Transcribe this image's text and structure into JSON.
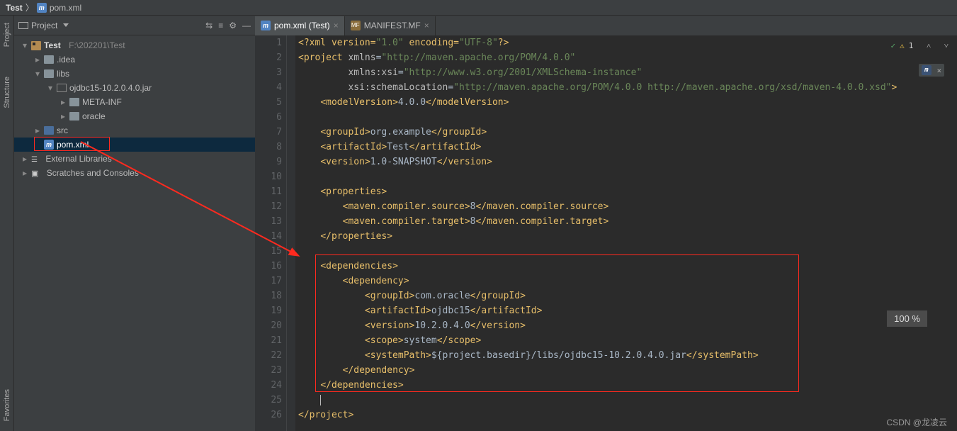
{
  "breadcrumb": {
    "root": "Test",
    "file": "pom.xml"
  },
  "sidebar": {
    "title": "Project",
    "tree": {
      "root": "Test",
      "rootPath": "F:\\202201\\Test",
      "idea": ".idea",
      "libs": "libs",
      "jar": "ojdbc15-10.2.0.4.0.jar",
      "meta": "META-INF",
      "oracle": "oracle",
      "src": "src",
      "pom": "pom.xml",
      "ext": "External Libraries",
      "scratch": "Scratches and Consoles"
    }
  },
  "vtabs": {
    "proj": "Project",
    "struct": "Structure",
    "fav": "Favorites"
  },
  "tabs": [
    {
      "label": "pom.xml (Test)",
      "active": true
    },
    {
      "label": "MANIFEST.MF",
      "active": false
    }
  ],
  "inspection": {
    "issues": "1"
  },
  "zoom": "100 %",
  "watermark": "CSDN @龙凌云",
  "maven_icon": "m",
  "chart_data": {
    "type": "table",
    "title": "pom.xml",
    "rows": [
      {
        "line": 1,
        "text": "<?xml version=\"1.0\" encoding=\"UTF-8\"?>"
      },
      {
        "line": 2,
        "text": "<project xmlns=\"http://maven.apache.org/POM/4.0.0\""
      },
      {
        "line": 3,
        "text": "         xmlns:xsi=\"http://www.w3.org/2001/XMLSchema-instance\""
      },
      {
        "line": 4,
        "text": "         xsi:schemaLocation=\"http://maven.apache.org/POM/4.0.0 http://maven.apache.org/xsd/maven-4.0.0.xsd\">"
      },
      {
        "line": 5,
        "text": "    <modelVersion>4.0.0</modelVersion>"
      },
      {
        "line": 6,
        "text": ""
      },
      {
        "line": 7,
        "text": "    <groupId>org.example</groupId>"
      },
      {
        "line": 8,
        "text": "    <artifactId>Test</artifactId>"
      },
      {
        "line": 9,
        "text": "    <version>1.0-SNAPSHOT</version>"
      },
      {
        "line": 10,
        "text": ""
      },
      {
        "line": 11,
        "text": "    <properties>"
      },
      {
        "line": 12,
        "text": "        <maven.compiler.source>8</maven.compiler.source>"
      },
      {
        "line": 13,
        "text": "        <maven.compiler.target>8</maven.compiler.target>"
      },
      {
        "line": 14,
        "text": "    </properties>"
      },
      {
        "line": 15,
        "text": ""
      },
      {
        "line": 16,
        "text": "    <dependencies>"
      },
      {
        "line": 17,
        "text": "        <dependency>"
      },
      {
        "line": 18,
        "text": "            <groupId>com.oracle</groupId>"
      },
      {
        "line": 19,
        "text": "            <artifactId>ojdbc15</artifactId>"
      },
      {
        "line": 20,
        "text": "            <version>10.2.0.4.0</version>"
      },
      {
        "line": 21,
        "text": "            <scope>system</scope>"
      },
      {
        "line": 22,
        "text": "            <systemPath>${project.basedir}/libs/ojdbc15-10.2.0.4.0.jar</systemPath>"
      },
      {
        "line": 23,
        "text": "        </dependency>"
      },
      {
        "line": 24,
        "text": "    </dependencies>"
      },
      {
        "line": 25,
        "text": ""
      },
      {
        "line": 26,
        "text": "</project>"
      }
    ]
  },
  "code_html": [
    "<span class='t-br'>&lt;?</span><span class='t-decl'>xml version=</span><span class='t-str'>\"1.0\"</span><span class='t-decl'> encoding=</span><span class='t-str'>\"UTF-8\"</span><span class='t-br'>?&gt;</span>",
    "<span class='t-br'>&lt;</span><span class='t-tag'>project </span><span class='t-attr'>xmlns</span>=<span class='t-str'>\"http://maven.apache.org/POM/4.0.0\"</span>",
    "         <span class='t-attr'>xmlns:xsi</span>=<span class='t-str'>\"http://www.w3.org/2001/XMLSchema-instance\"</span>",
    "         <span class='t-attr'>xsi:schemaLocation</span>=<span class='t-str'>\"http://maven.apache.org/POM/4.0.0 http://maven.apache.org/xsd/maven-4.0.0.xsd\"</span><span class='t-br'>&gt;</span>",
    "    <span class='t-br'>&lt;</span><span class='t-tag'>modelVersion</span><span class='t-br'>&gt;</span>4.0.0<span class='t-br'>&lt;/</span><span class='t-tag'>modelVersion</span><span class='t-br'>&gt;</span>",
    "",
    "    <span class='t-br'>&lt;</span><span class='t-tag'>groupId</span><span class='t-br'>&gt;</span>org.example<span class='t-br'>&lt;/</span><span class='t-tag'>groupId</span><span class='t-br'>&gt;</span>",
    "    <span class='t-br'>&lt;</span><span class='t-tag'>artifactId</span><span class='t-br'>&gt;</span>Test<span class='t-br'>&lt;/</span><span class='t-tag'>artifactId</span><span class='t-br'>&gt;</span>",
    "    <span class='t-br'>&lt;</span><span class='t-tag'>version</span><span class='t-br'>&gt;</span>1.0-SNAPSHOT<span class='t-br'>&lt;/</span><span class='t-tag'>version</span><span class='t-br'>&gt;</span>",
    "",
    "    <span class='t-br'>&lt;</span><span class='t-tag'>properties</span><span class='t-br'>&gt;</span>",
    "        <span class='t-br'>&lt;</span><span class='t-tag'>maven.compiler.source</span><span class='t-br'>&gt;</span>8<span class='t-br'>&lt;/</span><span class='t-tag'>maven.compiler.source</span><span class='t-br'>&gt;</span>",
    "        <span class='t-br'>&lt;</span><span class='t-tag'>maven.compiler.target</span><span class='t-br'>&gt;</span>8<span class='t-br'>&lt;/</span><span class='t-tag'>maven.compiler.target</span><span class='t-br'>&gt;</span>",
    "    <span class='t-br'>&lt;/</span><span class='t-tag'>properties</span><span class='t-br'>&gt;</span>",
    "",
    "    <span class='t-br'>&lt;</span><span class='t-tag'>dependencies</span><span class='t-br'>&gt;</span>",
    "        <span class='t-br'>&lt;</span><span class='t-tag'>dependency</span><span class='t-br'>&gt;</span>",
    "            <span class='t-br'>&lt;</span><span class='t-tag'>groupId</span><span class='t-br'>&gt;</span>com.oracle<span class='t-br'>&lt;/</span><span class='t-tag'>groupId</span><span class='t-br'>&gt;</span>",
    "            <span class='t-br'>&lt;</span><span class='t-tag'>artifactId</span><span class='t-br'>&gt;</span>ojdbc15<span class='t-br'>&lt;/</span><span class='t-tag'>artifactId</span><span class='t-br'>&gt;</span>",
    "            <span class='t-br'>&lt;</span><span class='t-tag'>version</span><span class='t-br'>&gt;</span>10.2.0.4.0<span class='t-br'>&lt;/</span><span class='t-tag'>version</span><span class='t-br'>&gt;</span>",
    "            <span class='t-br'>&lt;</span><span class='t-tag'>scope</span><span class='t-br'>&gt;</span>system<span class='t-br'>&lt;/</span><span class='t-tag'>scope</span><span class='t-br'>&gt;</span>",
    "            <span class='t-br'>&lt;</span><span class='t-tag'>systemPath</span><span class='t-br'>&gt;</span>${project.basedir}/libs/ojdbc15-10.2.0.4.0.jar<span class='t-br'>&lt;/</span><span class='t-tag'>systemPath</span><span class='t-br'>&gt;</span>",
    "        <span class='t-br'>&lt;/</span><span class='t-tag'>dependency</span><span class='t-br'>&gt;</span>",
    "    <span class='t-br'>&lt;/</span><span class='t-tag'>dependencies</span><span class='t-br'>&gt;</span>",
    "    <span class='cursor'></span>",
    "<span class='t-br'>&lt;/</span><span class='t-tag'>project</span><span class='t-br'>&gt;</span>"
  ]
}
